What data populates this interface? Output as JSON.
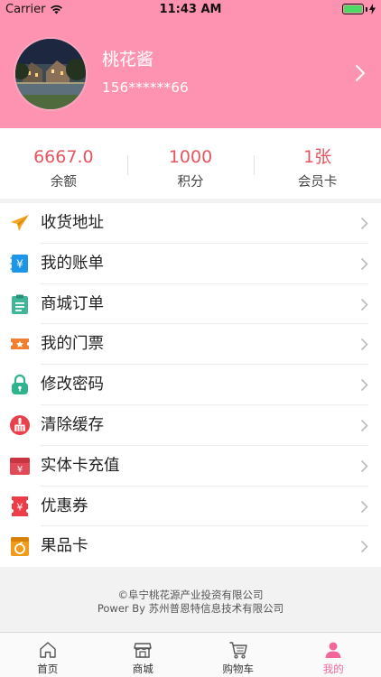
{
  "status_bar": {
    "carrier": "Carrier",
    "time": "11:43 AM"
  },
  "profile": {
    "name": "桃花酱",
    "phone": "156******66"
  },
  "stats": [
    {
      "value": "6667.0",
      "label": "余额"
    },
    {
      "value": "1000",
      "label": "积分"
    },
    {
      "value": "1张",
      "label": "会员卡"
    }
  ],
  "menu": [
    {
      "label": "收货地址",
      "icon": "paper-plane-icon",
      "color": "#f5a623"
    },
    {
      "label": "我的账单",
      "icon": "bill-yen-icon",
      "color": "#1e96e8"
    },
    {
      "label": "商城订单",
      "icon": "clipboard-icon",
      "color": "#3fb59a"
    },
    {
      "label": "我的门票",
      "icon": "ticket-icon",
      "color": "#f07f2f"
    },
    {
      "label": "修改密码",
      "icon": "lock-icon",
      "color": "#2fb38d"
    },
    {
      "label": "清除缓存",
      "icon": "broom-icon",
      "color": "#e8414b"
    },
    {
      "label": "实体卡充值",
      "icon": "card-yen-icon",
      "color": "#e24a57"
    },
    {
      "label": "优惠券",
      "icon": "coupon-icon",
      "color": "#ee3b48"
    },
    {
      "label": "果品卡",
      "icon": "fruit-box-icon",
      "color": "#f29b1a"
    }
  ],
  "copyright": {
    "line1": "©阜宁桃花源产业投资有限公司",
    "line2": "Power By 苏州普恩特信息技术有限公司"
  },
  "tabbar": [
    {
      "label": "首页",
      "icon": "home-icon",
      "active": false
    },
    {
      "label": "商城",
      "icon": "store-icon",
      "active": false
    },
    {
      "label": "购物车",
      "icon": "cart-icon",
      "active": false
    },
    {
      "label": "我的",
      "icon": "user-icon",
      "active": true
    }
  ],
  "colors": {
    "header_bg": "#fe93b1",
    "stat_value": "#e6555f",
    "tab_active": "#f2669a"
  }
}
